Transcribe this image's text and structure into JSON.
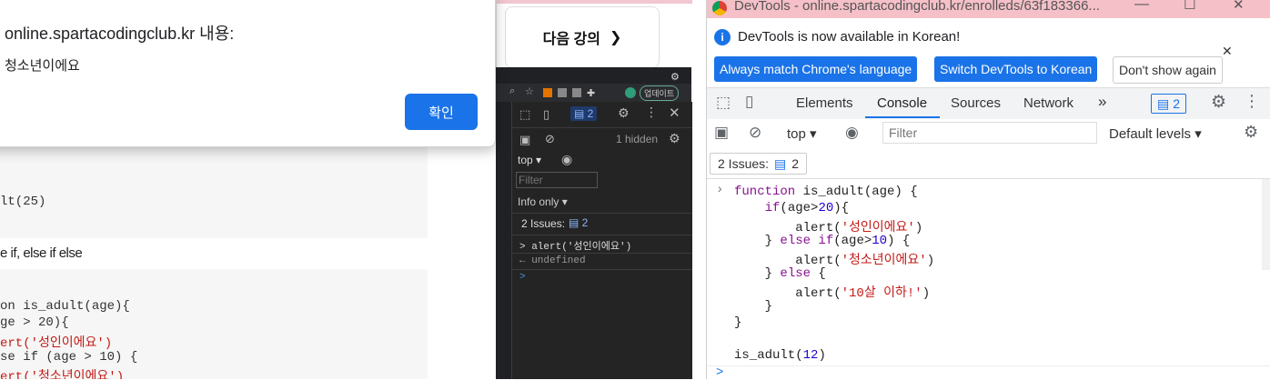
{
  "alert": {
    "title": "online.spartacodingclub.kr 내용:",
    "message": "청소년이에요",
    "ok_label": "확인"
  },
  "next_lecture": {
    "label": "다음 강의",
    "arrow": "❯"
  },
  "left_page": {
    "snippet_top": "lt(25)",
    "heading": "e if, else if else",
    "code": [
      "on is_adult(age){",
      "ge > 20){",
      "ert('성인이에요')",
      "se if (age > 10) {",
      "ert('청소년이에요')"
    ]
  },
  "mini_devtools": {
    "update_label": "업데이트",
    "hidden_count": "1 hidden",
    "context": "top",
    "filter_placeholder": "Filter",
    "level": "Info only",
    "issues_label": "2 Issues:",
    "issues_count": "2",
    "badge_count": "2",
    "lines": [
      "> alert('성인이에요')",
      "← undefined",
      ">"
    ]
  },
  "devtools": {
    "window_title": "DevTools - online.spartacodingclub.kr/enrolleds/63f183366...",
    "lang_message": "DevTools is now available in Korean!",
    "btn_match": "Always match Chrome's language",
    "btn_switch": "Switch DevTools to Korean",
    "btn_dont_show": "Don't show again",
    "tabs": [
      "Elements",
      "Console",
      "Sources",
      "Network"
    ],
    "active_tab": "Console",
    "more_tabs": "»",
    "issues_badge": "2",
    "context": "top",
    "filter_placeholder": "Filter",
    "levels": "Default levels",
    "issues_label": "2 Issues:",
    "issues_count": "2",
    "prompt": ">"
  },
  "colors": {
    "accent": "#1a73e8",
    "titlebar": "#f5c0c8",
    "keyword": "#881391",
    "string": "#c41a16",
    "number": "#1c00cf"
  }
}
